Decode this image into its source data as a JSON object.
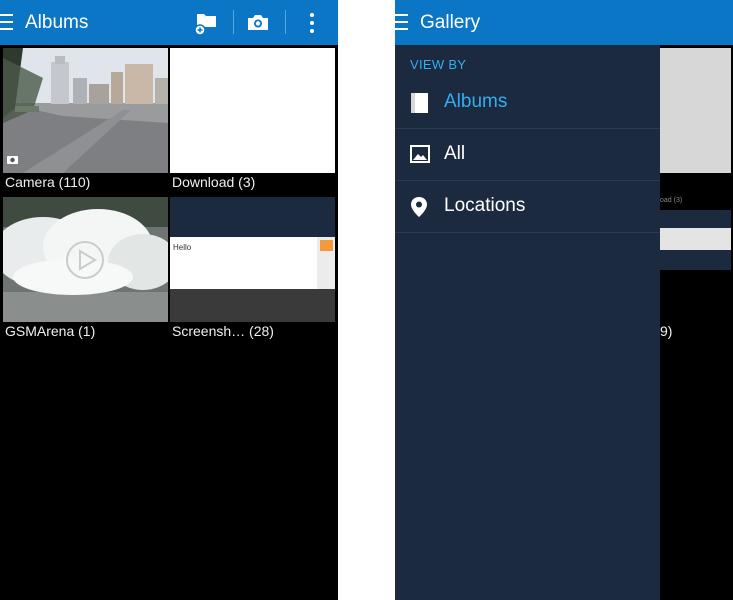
{
  "left_screen": {
    "title": "Albums",
    "toolbar": {
      "add_album_icon": "folder-plus-icon",
      "camera_icon": "camera-icon",
      "more_icon": "more-vert-icon"
    },
    "albums": [
      {
        "label": "Camera (110)"
      },
      {
        "label": "Download (3)"
      },
      {
        "label": "GSMArena (1)"
      },
      {
        "label": "Screensh… (28)"
      }
    ],
    "screenshot_thumb_text": "Hello"
  },
  "right_screen": {
    "title": "Gallery",
    "drawer": {
      "section_header": "VIEW BY",
      "items": [
        {
          "label": "Albums",
          "icon": "album-book-icon",
          "active": true
        },
        {
          "label": "All",
          "icon": "image-icon",
          "active": false
        },
        {
          "label": "Locations",
          "icon": "location-pin-icon",
          "active": false
        }
      ]
    },
    "behind": {
      "partial_label_1": "oad (3)",
      "partial_label_2": "9)"
    }
  },
  "colors": {
    "appbar": "#0b76c6",
    "drawer": "#1c2a40",
    "accent": "#32aef0",
    "background": "#000000"
  }
}
